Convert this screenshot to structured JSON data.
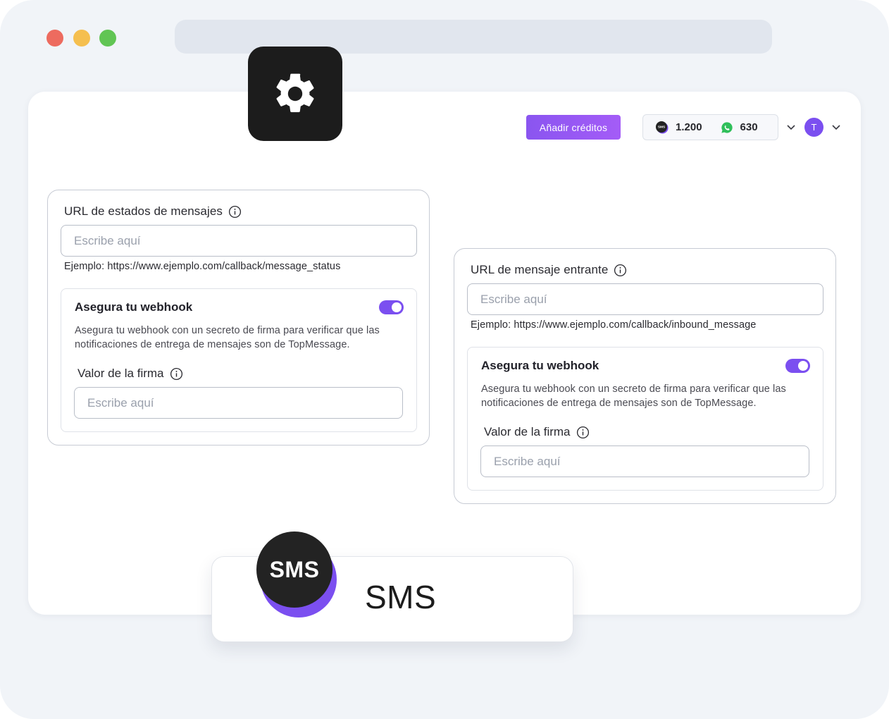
{
  "header": {
    "add_credits_label": "Añadir créditos",
    "sms_credits": "1.200",
    "whatsapp_credits": "630",
    "user_initial": "T"
  },
  "status_card": {
    "label": "URL de estados de mensajes",
    "placeholder": "Escribe aquí",
    "example": "Ejemplo: https://www.ejemplo.com/callback/message_status",
    "secure": {
      "title": "Asegura tu webhook",
      "enabled": true,
      "description": "Asegura tu webhook con un secreto de firma para verificar que las notificaciones de entrega de mensajes son de TopMessage.",
      "signature_label": "Valor de la firma",
      "signature_placeholder": "Escribe aquí"
    }
  },
  "inbound_card": {
    "label": "URL de mensaje entrante",
    "placeholder": "Escribe aquí",
    "example": "Ejemplo: https://www.ejemplo.com/callback/inbound_message",
    "secure": {
      "title": "Asegura tu webhook",
      "enabled": true,
      "description": "Asegura tu webhook con un secreto de firma para verificar que las notificaciones de entrega de mensajes son de TopMessage.",
      "signature_label": "Valor de la firma",
      "signature_placeholder": "Escribe aquí"
    }
  },
  "channel": {
    "badge_text": "SMS",
    "name": "SMS"
  },
  "icons": {
    "settings": "gear-icon",
    "info": "info-icon",
    "sms_credit": "sms-icon",
    "whatsapp_credit": "whatsapp-icon",
    "dropdown": "chevron-down-icon"
  },
  "colors": {
    "accent": "#7b4ff0",
    "whatsapp": "#2fbf5a",
    "dark_tile": "#1c1c1c"
  }
}
